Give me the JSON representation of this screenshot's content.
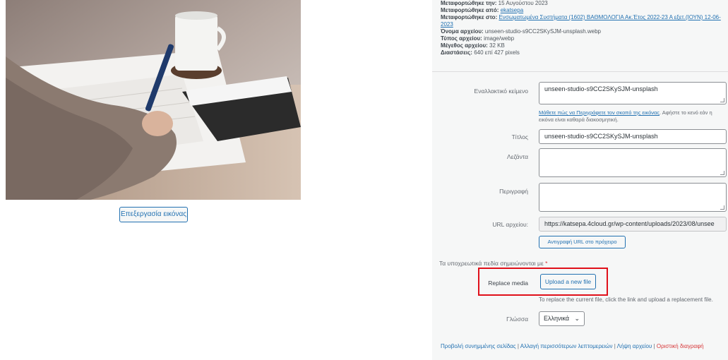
{
  "image_edit_button": "Επεξεργασία εικόνας",
  "meta": {
    "uploaded_on_label": "Μεταφορτώθηκε την:",
    "uploaded_on_value": "15 Αυγούστου 2023",
    "uploaded_by_label": "Μεταφορτώθηκε από:",
    "uploaded_by_value": "ekatsepa",
    "uploaded_to_label": "Μεταφορτώθηκε στο:",
    "uploaded_to_value": "Ενσωματωμένα Συστήματα (1602) ΒΑΘΜΟΛΟΓΙΑ Ακ.Έτος 2022-23 Α εξετ.(ΙΟΥΝ) 12-06-2023",
    "filename_label": "Όνομα αρχείου:",
    "filename_value": "unseen-studio-s9CC2SKySJM-unsplash.webp",
    "filetype_label": "Τύπος αρχείου:",
    "filetype_value": "image/webp",
    "filesize_label": "Μέγεθος αρχείου:",
    "filesize_value": "32 KB",
    "dimensions_label": "Διαστάσεις:",
    "dimensions_value": "640 επί 427 pixels"
  },
  "fields": {
    "alt_label": "Εναλλακτικό κείμενο",
    "alt_value": "unseen-studio-s9CC2SKySJM-unsplash",
    "alt_help_link": "Μάθετε πώς να Περιγράφετε τον σκοπό της εικόνας",
    "alt_help_text": ". Αφήστε το κενό εάν η εικόνα είναι καθαρά διακοσμητική.",
    "title_label": "Τίτλος",
    "title_value": "unseen-studio-s9CC2SKySJM-unsplash",
    "caption_label": "Λεζάντα",
    "caption_value": "",
    "description_label": "Περιγραφή",
    "description_value": "",
    "url_label": "URL αρχείου:",
    "url_value": "https://katsepa.4cloud.gr/wp-content/uploads/2023/08/unsee",
    "copy_url_button": "Αντιγραφή URL στο πρόχειρο"
  },
  "required_note": "Τα υποχρεωτικά πεδία σημειώνονται με",
  "required_star": "*",
  "replace": {
    "label": "Replace media",
    "button": "Upload a new file",
    "help": "To replace the current file, click the link and upload a replacement file."
  },
  "language": {
    "label": "Γλώσσα",
    "selected": "Ελληνικά",
    "chevron": "⌄"
  },
  "footer": {
    "view_page": "Προβολή συνημμένης σελίδας",
    "sep": " | ",
    "edit_more": "Αλλαγή περισσότερων λεπτομερειών",
    "download": "Λήψη αρχείου",
    "delete": "Οριστική διαγραφή"
  }
}
